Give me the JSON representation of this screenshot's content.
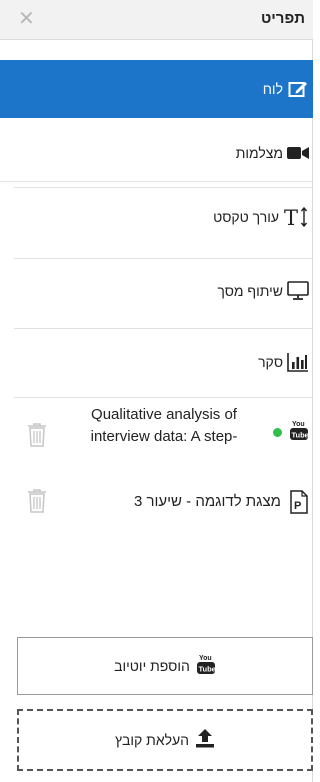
{
  "header": {
    "title": "תפריט",
    "close_symbol": "✕"
  },
  "menu": [
    {
      "label": "לוח",
      "icon": "edit-board-icon"
    },
    {
      "label": "מצלמות",
      "icon": "video-camera-icon"
    },
    {
      "label": "עורך טקסט",
      "icon": "text-editor-icon"
    },
    {
      "label": "שיתוף מסך",
      "icon": "monitor-icon"
    },
    {
      "label": "סקר",
      "icon": "bar-chart-icon"
    }
  ],
  "files": [
    {
      "title_line1": "Qualitative analysis of",
      "title_line2": "interview data: A step-",
      "type_icon": "youtube-icon",
      "status_color": "#2fbf4a"
    },
    {
      "title": "מצגת לדוגמה - שיעור 3",
      "type_icon": "ppt-file-icon"
    }
  ],
  "actions": {
    "add_youtube": "הוספת יוטיוב",
    "upload_file": "העלאת קובץ"
  },
  "colors": {
    "accent": "#1d75c9",
    "status_green": "#2fbf4a"
  }
}
